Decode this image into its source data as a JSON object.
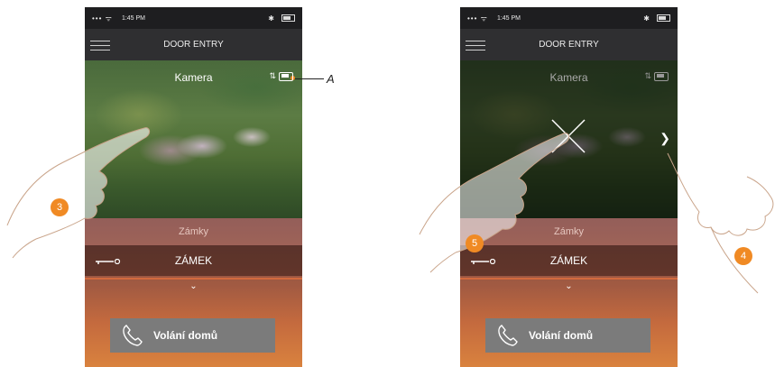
{
  "screens": [
    {
      "app_title": "DOOR ENTRY",
      "status_time": "1:45 PM",
      "camera_name": "Kamera",
      "locks_header": "Zámky",
      "lock_label": "ZÁMEK",
      "call_label": "Volání domů"
    },
    {
      "app_title": "DOOR ENTRY",
      "status_time": "1:45 PM",
      "camera_name": "Kamera",
      "locks_header": "Zámky",
      "lock_label": "ZÁMEK",
      "call_label": "Volání domů"
    }
  ],
  "annotations": {
    "step_left": "3",
    "step_close": "5",
    "step_next": "4",
    "label_a": "A"
  },
  "icons": [
    "menu-icon",
    "wifi-icon",
    "bluetooth-icon",
    "battery-icon",
    "audio-icon",
    "camera-battery-icon",
    "close-icon",
    "chevron-right-icon",
    "key-icon",
    "chevron-down-icon",
    "phone-icon"
  ],
  "colors": {
    "callout": "#f08a24",
    "topbar": "#2f2f31",
    "call_button": "#7b7b7b"
  }
}
